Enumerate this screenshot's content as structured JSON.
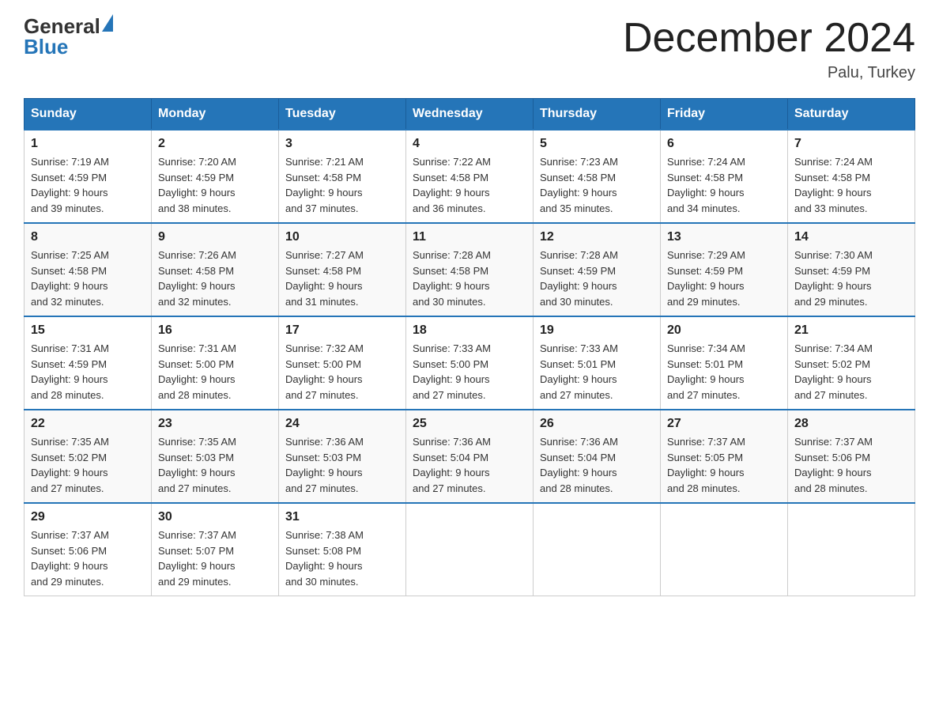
{
  "header": {
    "logo_general": "General",
    "logo_blue": "Blue",
    "month_title": "December 2024",
    "location": "Palu, Turkey"
  },
  "weekdays": [
    "Sunday",
    "Monday",
    "Tuesday",
    "Wednesday",
    "Thursday",
    "Friday",
    "Saturday"
  ],
  "weeks": [
    [
      {
        "day": "1",
        "sunrise": "7:19 AM",
        "sunset": "4:59 PM",
        "daylight": "9 hours and 39 minutes."
      },
      {
        "day": "2",
        "sunrise": "7:20 AM",
        "sunset": "4:59 PM",
        "daylight": "9 hours and 38 minutes."
      },
      {
        "day": "3",
        "sunrise": "7:21 AM",
        "sunset": "4:58 PM",
        "daylight": "9 hours and 37 minutes."
      },
      {
        "day": "4",
        "sunrise": "7:22 AM",
        "sunset": "4:58 PM",
        "daylight": "9 hours and 36 minutes."
      },
      {
        "day": "5",
        "sunrise": "7:23 AM",
        "sunset": "4:58 PM",
        "daylight": "9 hours and 35 minutes."
      },
      {
        "day": "6",
        "sunrise": "7:24 AM",
        "sunset": "4:58 PM",
        "daylight": "9 hours and 34 minutes."
      },
      {
        "day": "7",
        "sunrise": "7:24 AM",
        "sunset": "4:58 PM",
        "daylight": "9 hours and 33 minutes."
      }
    ],
    [
      {
        "day": "8",
        "sunrise": "7:25 AM",
        "sunset": "4:58 PM",
        "daylight": "9 hours and 32 minutes."
      },
      {
        "day": "9",
        "sunrise": "7:26 AM",
        "sunset": "4:58 PM",
        "daylight": "9 hours and 32 minutes."
      },
      {
        "day": "10",
        "sunrise": "7:27 AM",
        "sunset": "4:58 PM",
        "daylight": "9 hours and 31 minutes."
      },
      {
        "day": "11",
        "sunrise": "7:28 AM",
        "sunset": "4:58 PM",
        "daylight": "9 hours and 30 minutes."
      },
      {
        "day": "12",
        "sunrise": "7:28 AM",
        "sunset": "4:59 PM",
        "daylight": "9 hours and 30 minutes."
      },
      {
        "day": "13",
        "sunrise": "7:29 AM",
        "sunset": "4:59 PM",
        "daylight": "9 hours and 29 minutes."
      },
      {
        "day": "14",
        "sunrise": "7:30 AM",
        "sunset": "4:59 PM",
        "daylight": "9 hours and 29 minutes."
      }
    ],
    [
      {
        "day": "15",
        "sunrise": "7:31 AM",
        "sunset": "4:59 PM",
        "daylight": "9 hours and 28 minutes."
      },
      {
        "day": "16",
        "sunrise": "7:31 AM",
        "sunset": "5:00 PM",
        "daylight": "9 hours and 28 minutes."
      },
      {
        "day": "17",
        "sunrise": "7:32 AM",
        "sunset": "5:00 PM",
        "daylight": "9 hours and 27 minutes."
      },
      {
        "day": "18",
        "sunrise": "7:33 AM",
        "sunset": "5:00 PM",
        "daylight": "9 hours and 27 minutes."
      },
      {
        "day": "19",
        "sunrise": "7:33 AM",
        "sunset": "5:01 PM",
        "daylight": "9 hours and 27 minutes."
      },
      {
        "day": "20",
        "sunrise": "7:34 AM",
        "sunset": "5:01 PM",
        "daylight": "9 hours and 27 minutes."
      },
      {
        "day": "21",
        "sunrise": "7:34 AM",
        "sunset": "5:02 PM",
        "daylight": "9 hours and 27 minutes."
      }
    ],
    [
      {
        "day": "22",
        "sunrise": "7:35 AM",
        "sunset": "5:02 PM",
        "daylight": "9 hours and 27 minutes."
      },
      {
        "day": "23",
        "sunrise": "7:35 AM",
        "sunset": "5:03 PM",
        "daylight": "9 hours and 27 minutes."
      },
      {
        "day": "24",
        "sunrise": "7:36 AM",
        "sunset": "5:03 PM",
        "daylight": "9 hours and 27 minutes."
      },
      {
        "day": "25",
        "sunrise": "7:36 AM",
        "sunset": "5:04 PM",
        "daylight": "9 hours and 27 minutes."
      },
      {
        "day": "26",
        "sunrise": "7:36 AM",
        "sunset": "5:04 PM",
        "daylight": "9 hours and 28 minutes."
      },
      {
        "day": "27",
        "sunrise": "7:37 AM",
        "sunset": "5:05 PM",
        "daylight": "9 hours and 28 minutes."
      },
      {
        "day": "28",
        "sunrise": "7:37 AM",
        "sunset": "5:06 PM",
        "daylight": "9 hours and 28 minutes."
      }
    ],
    [
      {
        "day": "29",
        "sunrise": "7:37 AM",
        "sunset": "5:06 PM",
        "daylight": "9 hours and 29 minutes."
      },
      {
        "day": "30",
        "sunrise": "7:37 AM",
        "sunset": "5:07 PM",
        "daylight": "9 hours and 29 minutes."
      },
      {
        "day": "31",
        "sunrise": "7:38 AM",
        "sunset": "5:08 PM",
        "daylight": "9 hours and 30 minutes."
      },
      null,
      null,
      null,
      null
    ]
  ],
  "labels": {
    "sunrise_prefix": "Sunrise: ",
    "sunset_prefix": "Sunset: ",
    "daylight_prefix": "Daylight: "
  }
}
